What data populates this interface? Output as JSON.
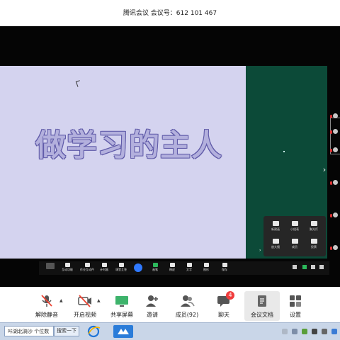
{
  "window": {
    "title": "腾讯会议  会议号：612 101 467"
  },
  "slide": {
    "heading": "做学习的主人",
    "colors": {
      "background": "#d4d3ef",
      "side_panel": "#0c4a38",
      "heading_fill": "#b3b0dd",
      "heading_outline": "#5f5aa8"
    }
  },
  "float_panel": {
    "items": [
      {
        "icon": "camera-icon",
        "label": "新建画"
      },
      {
        "icon": "group-icon",
        "label": "小组表"
      },
      {
        "icon": "stop-icon",
        "label": "聚光灯"
      },
      {
        "icon": "whiteboard-icon",
        "label": "放大镜"
      },
      {
        "icon": "document-icon",
        "label": "成员"
      },
      {
        "icon": "chart-icon",
        "label": "投票"
      }
    ]
  },
  "slide_toolbar": {
    "items": [
      {
        "icon": "interact-icon",
        "label": "互动功能"
      },
      {
        "icon": "template-icon",
        "label": "作业互动件"
      },
      {
        "icon": "timer-icon",
        "label": "计时器"
      },
      {
        "icon": "classroom-icon",
        "label": "课堂互答"
      },
      {
        "icon": "pen-icon",
        "label": "画笔"
      },
      {
        "icon": "eraser-icon",
        "label": "橡皮"
      },
      {
        "icon": "text-icon",
        "label": "文字"
      },
      {
        "icon": "shape-icon",
        "label": "图形"
      },
      {
        "icon": "save-icon",
        "label": "保存"
      }
    ]
  },
  "toolbar": {
    "items": [
      {
        "key": "mute",
        "label": "解除静音",
        "icon": "mic-muted-icon"
      },
      {
        "key": "video",
        "label": "开启视频",
        "icon": "camera-off-icon"
      },
      {
        "key": "share",
        "label": "共享屏幕",
        "icon": "screen-share-icon"
      },
      {
        "key": "invite",
        "label": "邀请",
        "icon": "add-user-icon"
      },
      {
        "key": "members",
        "label": "成员(92)",
        "icon": "members-icon"
      },
      {
        "key": "chat",
        "label": "聊天",
        "icon": "chat-icon",
        "badge": "4"
      },
      {
        "key": "docs",
        "label": "会议文档",
        "icon": "document-icon"
      },
      {
        "key": "settings",
        "label": "设置",
        "icon": "settings-grid-icon"
      }
    ],
    "badge_color": "#f03c3c"
  },
  "taskbar": {
    "search_text": "咔湖北骑沙 个位数",
    "search_button": "搜索一下"
  }
}
